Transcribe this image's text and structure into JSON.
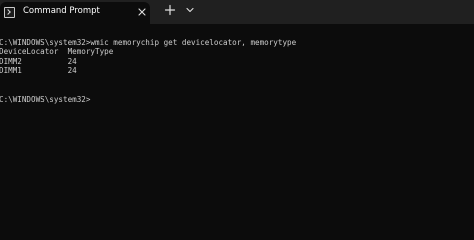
{
  "tab": {
    "title": "Command Prompt",
    "icon": "terminal-icon",
    "close_icon": "close-icon",
    "new_tab_icon": "plus-icon",
    "dropdown_icon": "chevron-down-icon"
  },
  "colors": {
    "titlebar": "#202020",
    "terminal_bg": "#0c0c0c",
    "text": "#cccccc"
  },
  "terminal": {
    "lines": [
      "",
      "C:\\WINDOWS\\system32>wmic memorychip get devicelocator, memorytype",
      "DeviceLocator  MemoryType",
      "DIMM2          24",
      "DIMM1          24",
      "",
      "",
      "C:\\WINDOWS\\system32>"
    ]
  }
}
